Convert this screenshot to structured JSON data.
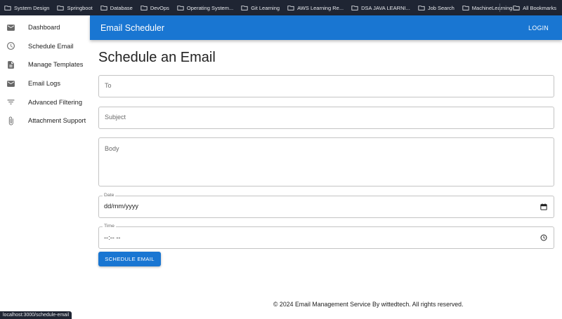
{
  "bookmarks": {
    "items": [
      {
        "label": "System Design"
      },
      {
        "label": "Springboot"
      },
      {
        "label": "Database"
      },
      {
        "label": "DevOps"
      },
      {
        "label": "Operating System..."
      },
      {
        "label": "Git Learning"
      },
      {
        "label": "AWS Learning Re..."
      },
      {
        "label": "DSA JAVA LEARNI..."
      },
      {
        "label": "Job Search"
      },
      {
        "label": "MachineLearning-..."
      }
    ],
    "all_label": "All Bookmarks"
  },
  "sidebar": {
    "items": [
      {
        "label": "Dashboard",
        "icon": "mail-icon"
      },
      {
        "label": "Schedule Email",
        "icon": "clock-icon"
      },
      {
        "label": "Manage Templates",
        "icon": "document-icon"
      },
      {
        "label": "Email Logs",
        "icon": "mail-icon"
      },
      {
        "label": "Advanced Filtering",
        "icon": "filter-icon"
      },
      {
        "label": "Attachment Support",
        "icon": "paperclip-icon"
      }
    ]
  },
  "appbar": {
    "title": "Email Scheduler",
    "login_label": "LOGIN",
    "color": "#1976d2"
  },
  "main": {
    "heading": "Schedule an Email",
    "to_placeholder": "To",
    "subject_placeholder": "Subject",
    "body_placeholder": "Body",
    "date_label": "Date",
    "date_value": "dd/mm/yyyy",
    "time_label": "Time",
    "time_value": "--:-- --",
    "submit_label": "SCHEDULE EMAIL"
  },
  "footer": {
    "text": "© 2024 Email Management Service By wittedtech. All rights reserved."
  },
  "status_bar": {
    "url": "localhost:3000/schedule-email"
  }
}
